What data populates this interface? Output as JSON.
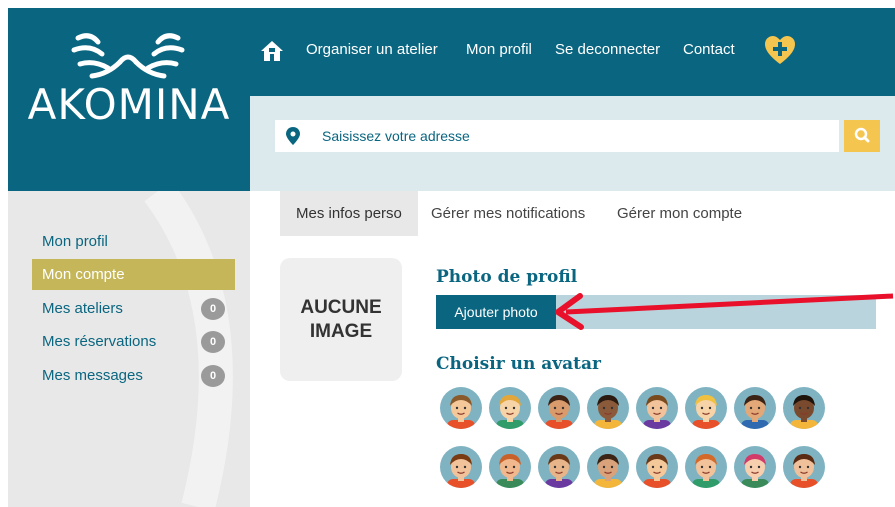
{
  "brand": {
    "name": "AKOMINA"
  },
  "nav": {
    "items": [
      "Organiser un atelier",
      "Mon profil",
      "Se deconnecter",
      "Contact"
    ]
  },
  "search": {
    "placeholder": "Saisissez votre adresse"
  },
  "sidebar": {
    "items": [
      {
        "label": "Mon profil",
        "badge": null
      },
      {
        "label": "Mon compte",
        "badge": null,
        "active": true
      },
      {
        "label": "Mes ateliers",
        "badge": "0"
      },
      {
        "label": "Mes réservations",
        "badge": "0"
      },
      {
        "label": "Mes messages",
        "badge": "0"
      }
    ]
  },
  "tabs": [
    "Mes infos perso",
    "Gérer mes notifications",
    "Gérer mon compte"
  ],
  "profile": {
    "no_image_line1": "AUCUNE",
    "no_image_line2": "IMAGE",
    "photo_title": "Photo de profil",
    "add_photo": "Ajouter photo",
    "avatar_title": "Choisir un avatar"
  },
  "colors": {
    "primary": "#0a6680",
    "accent": "#f4c54f",
    "active_sidebar": "#c5b65a",
    "arrow": "#e8102a"
  },
  "avatars": {
    "count": 16,
    "icon": "avatar-face-icon"
  }
}
